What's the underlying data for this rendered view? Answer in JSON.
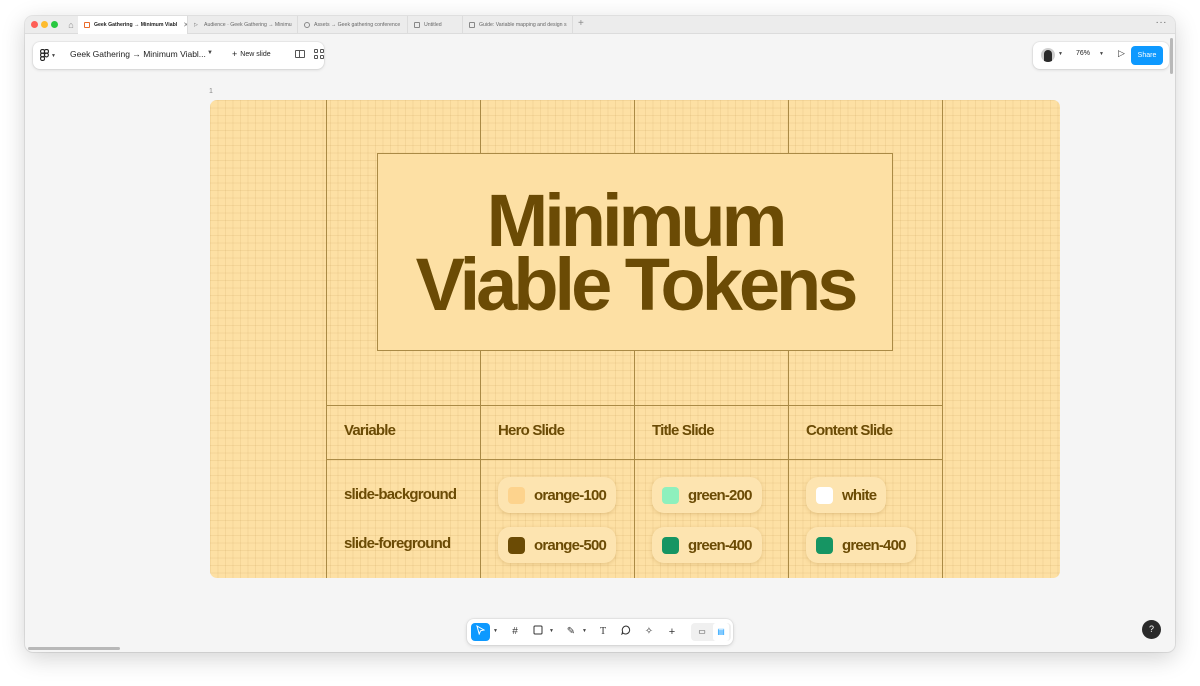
{
  "tabs": [
    {
      "label": "Geek Gathering → Minimum Viabl",
      "active": true
    },
    {
      "label": "Audience · Geek Gathering → Minimu",
      "active": false
    },
    {
      "label": "Assets → Geek gathering conference",
      "active": false
    },
    {
      "label": "Untitled",
      "active": false
    },
    {
      "label": "Guide: Variable mapping and design s",
      "active": false
    }
  ],
  "toolbar": {
    "file_title": "Geek Gathering → Minimum Viabl...",
    "new_slide_label": "New slide",
    "zoom": "76%",
    "share_label": "Share"
  },
  "slide": {
    "number": "1",
    "title_line1": "Minimum",
    "title_line2": "Viable Tokens",
    "columns": [
      "Variable",
      "Hero Slide",
      "Title Slide",
      "Content Slide"
    ],
    "rows": [
      {
        "variable": "slide-background",
        "values": [
          {
            "label": "orange-100",
            "color": "#fdd38d"
          },
          {
            "label": "green-200",
            "color": "#8ef0bd"
          },
          {
            "label": "white",
            "color": "#ffffff"
          }
        ]
      },
      {
        "variable": "slide-foreground",
        "values": [
          {
            "label": "orange-500",
            "color": "#6b4b05"
          },
          {
            "label": "green-400",
            "color": "#169563"
          },
          {
            "label": "green-400",
            "color": "#169563"
          }
        ]
      }
    ]
  },
  "help_label": "?",
  "icons": [
    "home-icon",
    "figma-logo-icon",
    "plus-icon",
    "single-view-icon",
    "grid-view-icon",
    "avatar",
    "present-icon",
    "move-tool-icon",
    "frame-tool-icon",
    "shape-tool-icon",
    "pen-tool-icon",
    "text-tool-icon",
    "comment-tool-icon",
    "actions-tool-icon",
    "add-tool-icon"
  ]
}
